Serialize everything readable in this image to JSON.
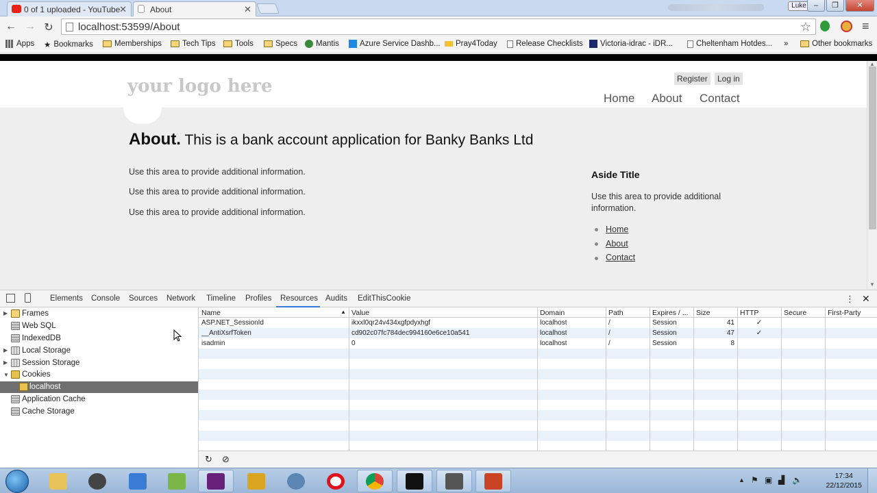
{
  "browser": {
    "tabs": [
      {
        "title": "0 of 1 uploaded - YouTube",
        "active": false,
        "icon": "youtube-icon",
        "icon_color": "#e62117"
      },
      {
        "title": "About",
        "active": true,
        "icon": "page-icon"
      }
    ],
    "profile_label": "Luke",
    "address": "localhost:53599/About",
    "bookmarks": [
      {
        "label": "Apps",
        "icon": "apps-icon"
      },
      {
        "label": "Bookmarks",
        "icon": "star-icon"
      },
      {
        "label": "Memberships",
        "icon": "folder-icon"
      },
      {
        "label": "Tech Tips",
        "icon": "folder-icon"
      },
      {
        "label": "Tools",
        "icon": "folder-icon"
      },
      {
        "label": "Specs",
        "icon": "folder-icon"
      },
      {
        "label": "Mantis",
        "icon": "mantis-icon"
      },
      {
        "label": "Azure Service Dashb...",
        "icon": "windows-icon"
      },
      {
        "label": "Pray4Today",
        "icon": "pray-icon"
      },
      {
        "label": "Release Checklists",
        "icon": "page-icon"
      },
      {
        "label": "Victoria-idrac - iDR...",
        "icon": "idrac-icon"
      },
      {
        "label": "Cheltenham Hotdes...",
        "icon": "page-icon"
      },
      {
        "label": "»",
        "icon": ""
      },
      {
        "label": "Other bookmarks",
        "icon": "folder-icon"
      }
    ]
  },
  "site": {
    "logo": "your logo here",
    "login_links": [
      "Register",
      "Log in"
    ],
    "nav": [
      "Home",
      "About",
      "Contact"
    ],
    "heading_bold": "About.",
    "heading_text": "This is a bank account application for Banky Banks Ltd",
    "paragraphs": [
      "Use this area to provide additional information.",
      "Use this area to provide additional information.",
      "Use this area to provide additional information."
    ],
    "aside_title": "Aside Title",
    "aside_text": "Use this area to provide additional information.",
    "aside_links": [
      "Home",
      "About",
      "Contact"
    ]
  },
  "devtools": {
    "tabs": [
      "Elements",
      "Console",
      "Sources",
      "Network",
      "Timeline",
      "Profiles",
      "Resources",
      "Audits",
      "EditThisCookie"
    ],
    "active_tab": "Resources",
    "tree": [
      {
        "label": "Frames",
        "icon": "folder",
        "expand": "▶"
      },
      {
        "label": "Web SQL",
        "icon": "db",
        "expand": ""
      },
      {
        "label": "IndexedDB",
        "icon": "db",
        "expand": ""
      },
      {
        "label": "Local Storage",
        "icon": "grid",
        "expand": "▶"
      },
      {
        "label": "Session Storage",
        "icon": "grid",
        "expand": "▶"
      },
      {
        "label": "Cookies",
        "icon": "cookie",
        "expand": "▼"
      },
      {
        "label": "localhost",
        "icon": "cookie",
        "expand": "",
        "selected": true
      },
      {
        "label": "Application Cache",
        "icon": "db",
        "expand": ""
      },
      {
        "label": "Cache Storage",
        "icon": "db",
        "expand": ""
      }
    ],
    "cookie_columns": [
      "Name",
      "Value",
      "Domain",
      "Path",
      "Expires / ...",
      "Size",
      "HTTP",
      "Secure",
      "First-Party"
    ],
    "cookies": [
      {
        "name": "ASP.NET_SessionId",
        "value": "ikxxl0qr24v434xgfpdyxhgf",
        "domain": "localhost",
        "path": "/",
        "expires": "Session",
        "size": "41",
        "http": "✓",
        "secure": "",
        "first_party": ""
      },
      {
        "name": "__AntiXsrfToken",
        "value": "cd902c07fc784dec994160e6ce10a541",
        "domain": "localhost",
        "path": "/",
        "expires": "Session",
        "size": "47",
        "http": "✓",
        "secure": "",
        "first_party": ""
      },
      {
        "name": "isadmin",
        "value": "0",
        "domain": "localhost",
        "path": "/",
        "expires": "Session",
        "size": "8",
        "http": "",
        "secure": "",
        "first_party": ""
      }
    ]
  },
  "taskbar": {
    "apps": [
      {
        "name": "explorer-icon",
        "color": "#e8c35a"
      },
      {
        "name": "keepass-icon",
        "color": "#444444"
      },
      {
        "name": "remote-desktop-icon",
        "color": "#3a7bd5"
      },
      {
        "name": "notepad-chart-icon",
        "color": "#7ab648"
      },
      {
        "name": "visual-studio-icon",
        "color": "#68217a"
      },
      {
        "name": "snipping-tool-icon",
        "color": "#d9a520"
      },
      {
        "name": "network-icon",
        "color": "#5b86b3"
      },
      {
        "name": "opera-icon",
        "color": "#e0121b"
      },
      {
        "name": "chrome-icon",
        "color": "#4caf50"
      },
      {
        "name": "cmd-icon",
        "color": "#111111"
      },
      {
        "name": "folder-icon",
        "color": "#555555"
      },
      {
        "name": "powerpoint-icon",
        "color": "#c94324"
      }
    ],
    "time": "17:34",
    "date": "22/12/2015"
  }
}
